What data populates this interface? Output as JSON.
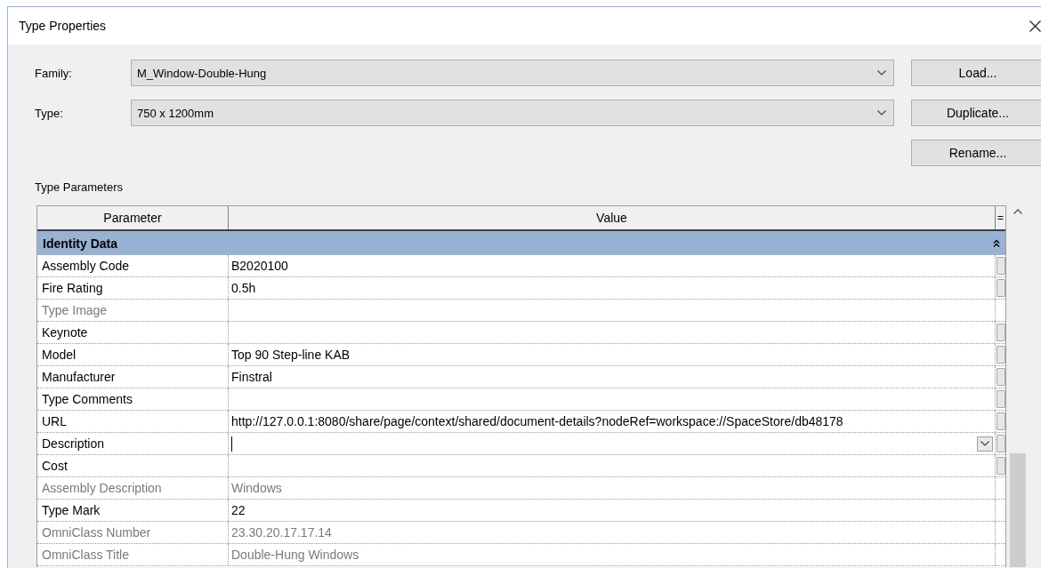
{
  "window": {
    "title": "Type Properties"
  },
  "fields": [
    {
      "label": "Family:",
      "value": "M_Window-Double-Hung"
    },
    {
      "label": "Type:",
      "value": "750 x 1200mm"
    }
  ],
  "buttons": [
    "Load...",
    "Duplicate...",
    "Rename..."
  ],
  "type_parameters": {
    "label": "Type Parameters",
    "columns": [
      "Parameter",
      "Value",
      "="
    ],
    "groups": [
      {
        "name": "Identity Data",
        "expanded": true,
        "rows": [
          {
            "parameter": "Assembly Code",
            "value": "B2020100",
            "disabled": false,
            "associate_button": true,
            "editing": false
          },
          {
            "parameter": "Fire Rating",
            "value": "0.5h",
            "disabled": false,
            "associate_button": true,
            "editing": false
          },
          {
            "parameter": "Type Image",
            "disabled": true,
            "associate_button": false,
            "editing": false
          },
          {
            "parameter": "Keynote",
            "disabled": false,
            "associate_button": true,
            "editing": false
          },
          {
            "parameter": "Model",
            "value": "Top 90 Step-line KAB",
            "disabled": false,
            "associate_button": true,
            "editing": false
          },
          {
            "parameter": "Manufacturer",
            "value": "Finstral",
            "disabled": false,
            "associate_button": true,
            "editing": false
          },
          {
            "parameter": "Type Comments",
            "disabled": false,
            "associate_button": true,
            "editing": false
          },
          {
            "parameter": "URL",
            "value": "http://127.0.0.1:8080/share/page/context/shared/document-details?nodeRef=workspace://SpaceStore/db48178",
            "disabled": false,
            "associate_button": true,
            "editing": false
          },
          {
            "parameter": "Description",
            "disabled": false,
            "associate_button": true,
            "editing": true
          },
          {
            "parameter": "Cost",
            "disabled": false,
            "associate_button": true,
            "editing": false
          },
          {
            "parameter": "Assembly Description",
            "value": "Windows",
            "disabled": true,
            "associate_button": false,
            "editing": false
          },
          {
            "parameter": "Type Mark",
            "value": "22",
            "disabled": false,
            "associate_button": false,
            "editing": false
          },
          {
            "parameter": "OmniClass Number",
            "value": "23.30.20.17.17.14",
            "disabled": true,
            "associate_button": false,
            "editing": false
          },
          {
            "parameter": "OmniClass Title",
            "value": "Double-Hung Windows",
            "disabled": true,
            "associate_button": false,
            "editing": false
          }
        ]
      }
    ]
  }
}
